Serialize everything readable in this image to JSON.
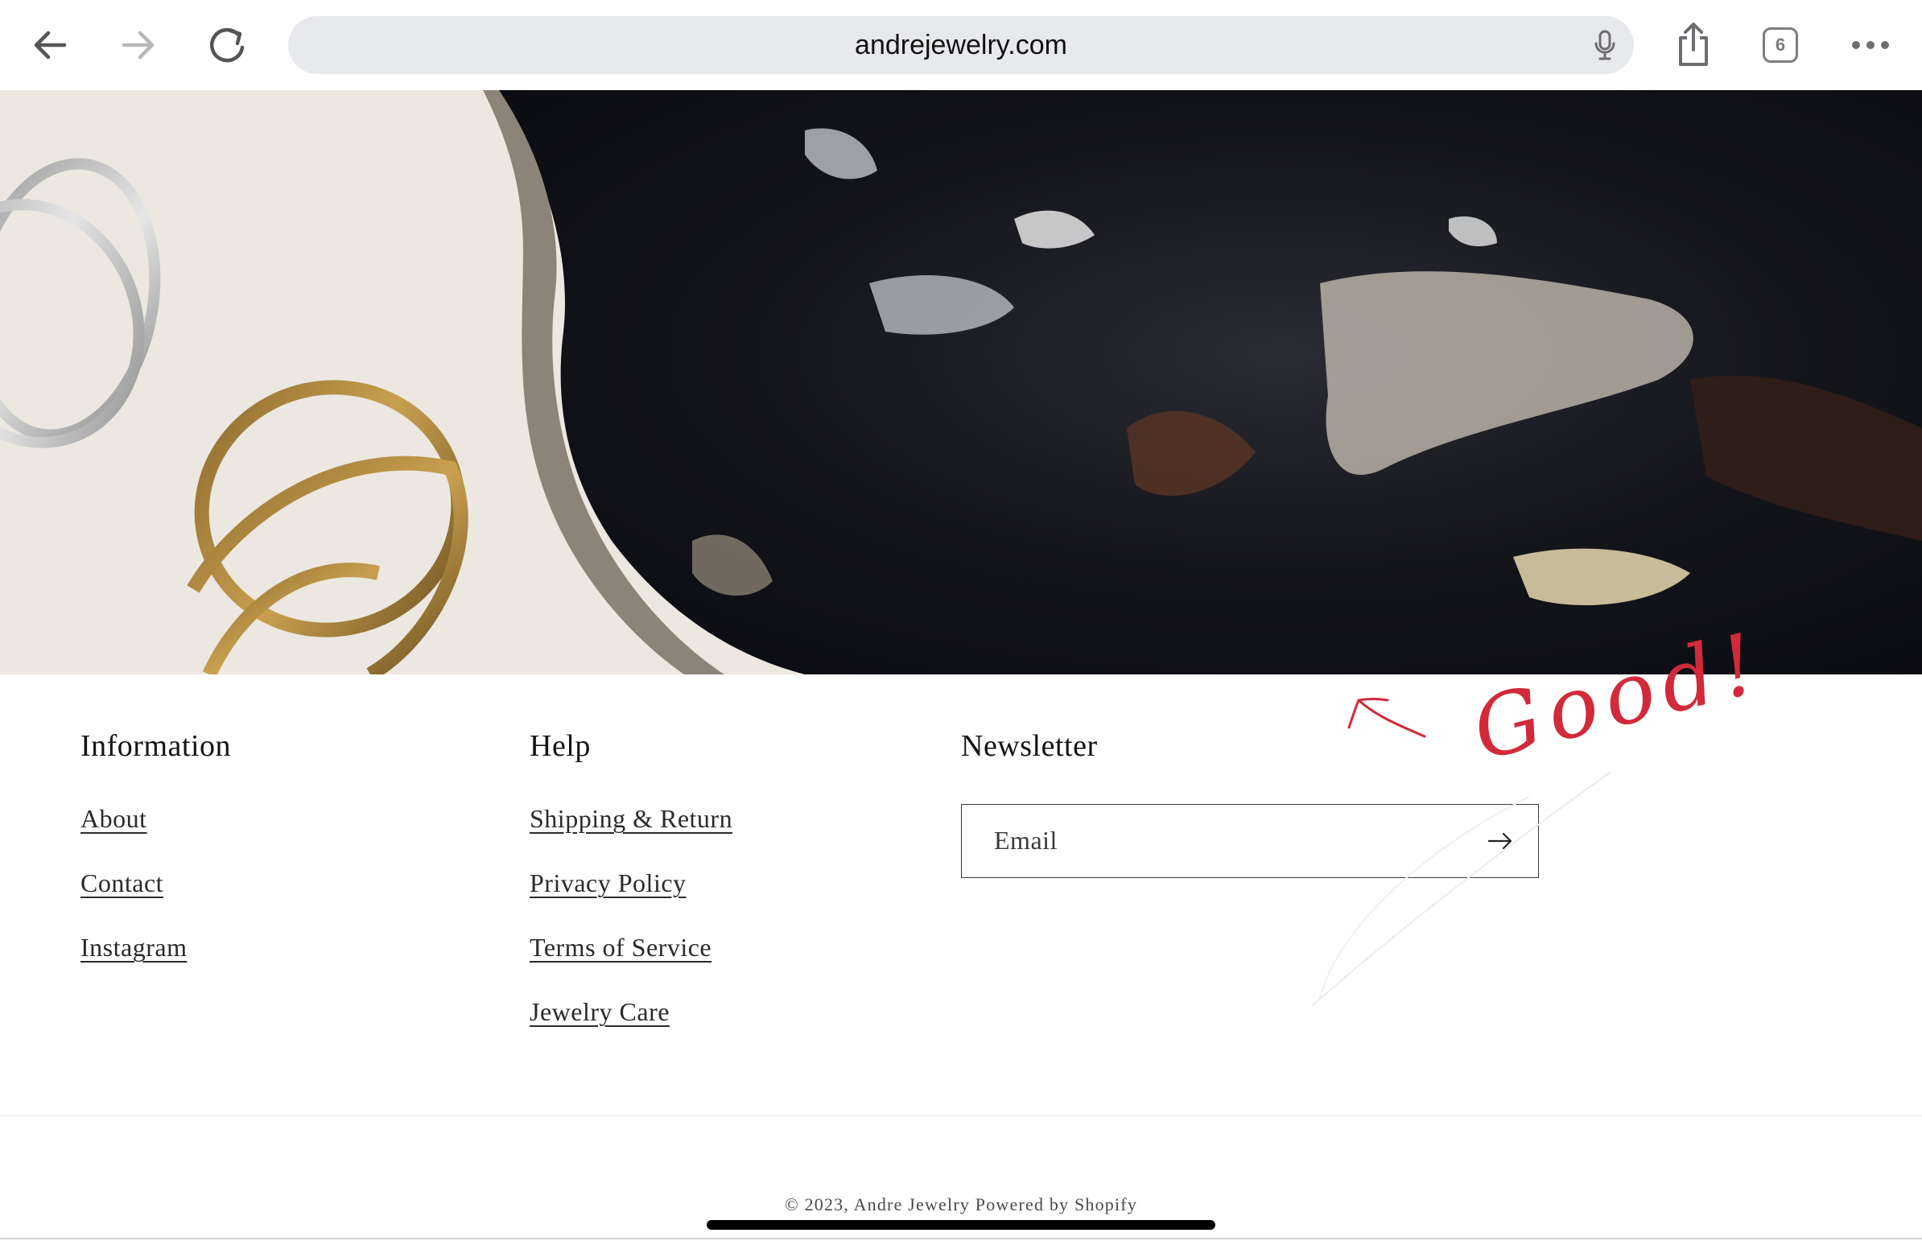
{
  "browser": {
    "url": "andrejewelry.com",
    "tab_count": "6",
    "icons": {
      "back": "arrow-left-icon",
      "forward": "arrow-right-icon",
      "reload": "reload-icon",
      "mic": "microphone-icon",
      "share": "share-icon",
      "tabs": "tabs-icon",
      "more": "more-dots-icon"
    }
  },
  "footer": {
    "information": {
      "heading": "Information",
      "links": [
        "About",
        "Contact",
        "Instagram"
      ]
    },
    "help": {
      "heading": "Help",
      "links": [
        "Shipping & Return",
        "Privacy Policy",
        "Terms of Service",
        "Jewelry Care"
      ]
    },
    "newsletter": {
      "heading": "Newsletter",
      "email_placeholder": "Email"
    },
    "copyright": "© 2023, Andre Jewelry Powered by Shopify"
  },
  "annotation": {
    "text": "Good!",
    "color": "#d22a3a"
  }
}
